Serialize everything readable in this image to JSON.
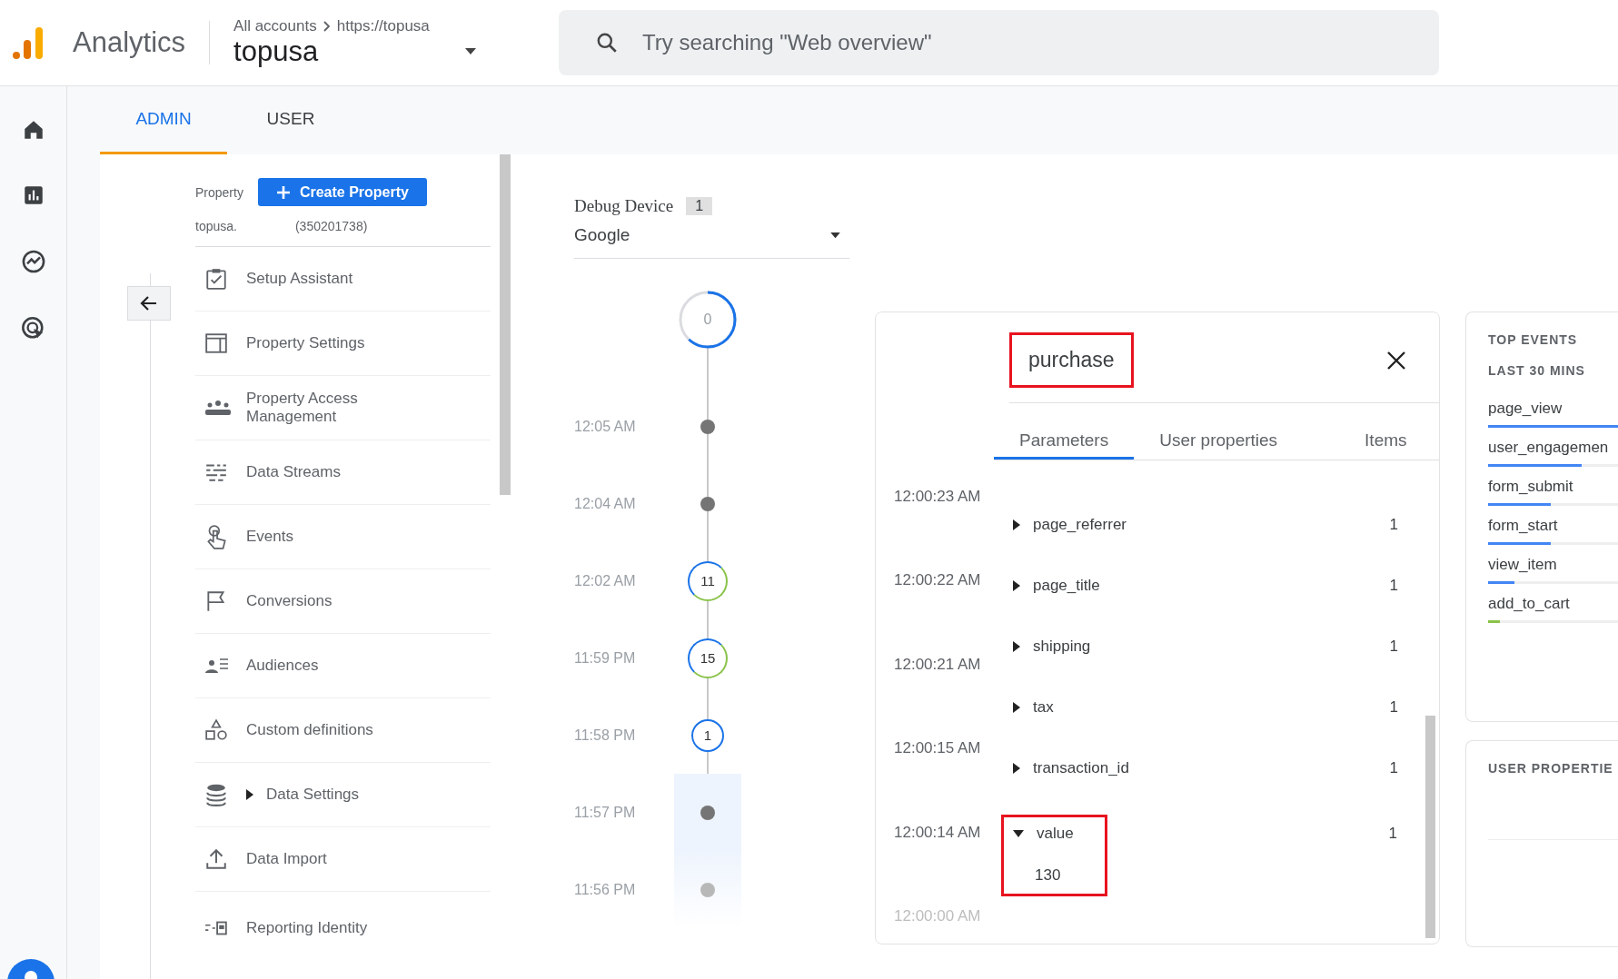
{
  "header": {
    "product": "Analytics",
    "breadcrumbs": [
      "All accounts",
      "https://topusa"
    ],
    "account": "topusa",
    "search": {
      "placeholder": "Try searching \"Web overview\""
    }
  },
  "rail": [
    {
      "kind": "home"
    },
    {
      "kind": "reports"
    },
    {
      "kind": "explore"
    },
    {
      "kind": "advertising"
    }
  ],
  "tabs": [
    {
      "label": "ADMIN",
      "selected": true
    },
    {
      "label": "USER",
      "selected": false
    }
  ],
  "property": {
    "label": "Property",
    "create_button": "Create Property",
    "name": "topusa.",
    "id": "(350201738)"
  },
  "nav": [
    {
      "label": "Setup Assistant",
      "kind": "setup"
    },
    {
      "label": "Property Settings",
      "kind": "settings"
    },
    {
      "label": "Property Access Management",
      "kind": "access"
    },
    {
      "label": "Data Streams",
      "kind": "streams"
    },
    {
      "label": "Events",
      "kind": "events"
    },
    {
      "label": "Conversions",
      "kind": "conversions"
    },
    {
      "label": "Audiences",
      "kind": "audiences"
    },
    {
      "label": "Custom definitions",
      "kind": "custom"
    },
    {
      "label": "Data Settings",
      "kind": "data",
      "expanded": false
    },
    {
      "label": "Data Import",
      "kind": "import"
    },
    {
      "label": "Reporting Identity",
      "kind": "identity"
    }
  ],
  "debug_device": {
    "label": "Debug Device",
    "count": "1",
    "value": "Google"
  },
  "timeline": {
    "countdown": {
      "count": "0",
      "level": 0.62
    },
    "items": [
      {
        "time": "12:05 AM",
        "kind": "dot",
        "selected": false
      },
      {
        "time": "12:04 AM",
        "kind": "dot",
        "selected": false
      },
      {
        "time": "12:02 AM",
        "kind": "ring_mixed",
        "count": "11",
        "selected": false
      },
      {
        "time": "11:59 PM",
        "kind": "ring_mixed",
        "count": "15",
        "selected": false
      },
      {
        "time": "11:58 PM",
        "kind": "ring",
        "count": "1",
        "selected": false
      },
      {
        "time": "11:57 PM",
        "kind": "dot",
        "selected": true
      },
      {
        "time": "11:56 PM",
        "kind": "dot",
        "selected": true
      }
    ]
  },
  "event": {
    "name": "purchase",
    "highlighted": true,
    "tabs": [
      {
        "label": "Parameters",
        "selected": true
      },
      {
        "label": "User properties",
        "selected": false
      },
      {
        "label": "Items",
        "selected": false
      }
    ],
    "times": [
      "12:00:23 AM",
      "12:00:22 AM",
      "12:00:21 AM",
      "12:00:15 AM",
      "12:00:14 AM",
      "12:00:00 AM"
    ],
    "parameters": [
      {
        "name": "page_referrer",
        "count": "1",
        "expanded": false,
        "highlighted": false
      },
      {
        "name": "page_title",
        "count": "1",
        "expanded": false,
        "highlighted": false
      },
      {
        "name": "shipping",
        "count": "1",
        "expanded": false,
        "highlighted": false
      },
      {
        "name": "tax",
        "count": "1",
        "expanded": false,
        "highlighted": false
      },
      {
        "name": "transaction_id",
        "count": "1",
        "expanded": false,
        "highlighted": false
      },
      {
        "name": "value",
        "count": "1",
        "expanded": true,
        "highlighted": true,
        "value": "130"
      }
    ]
  },
  "top_events": {
    "title": "TOP EVENTS",
    "subtitle": "LAST 30 MINS",
    "items": [
      {
        "name": "page_view",
        "level": 1.0,
        "color": "#4285f4"
      },
      {
        "name": "user_engagemen",
        "level": 0.72,
        "color": "#4285f4"
      },
      {
        "name": "form_submit",
        "level": 0.48,
        "color": "#4285f4"
      },
      {
        "name": "form_start",
        "level": 0.48,
        "color": "#4285f4"
      },
      {
        "name": "view_item",
        "level": 0.2,
        "color": "#4285f4"
      },
      {
        "name": "add_to_cart",
        "level": 0.09,
        "color": "#8bc34a"
      }
    ]
  },
  "user_properties": {
    "title": "USER PROPERTIE"
  }
}
